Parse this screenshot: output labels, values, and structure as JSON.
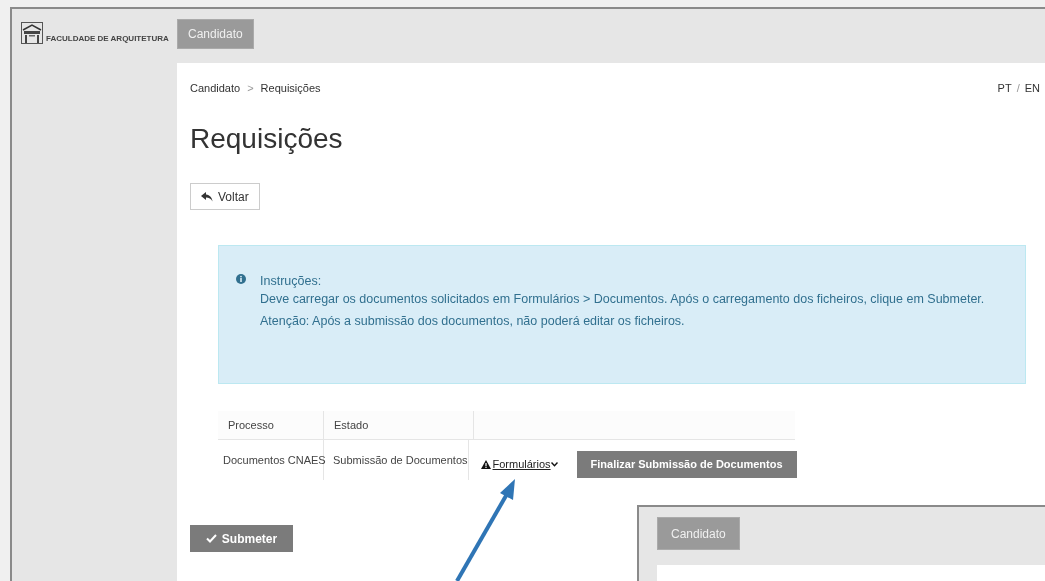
{
  "logo": {
    "title": "FACULDADE DE ARQUITETURA"
  },
  "top_tabs": [
    {
      "label": "Candidato",
      "selected": true
    }
  ],
  "breadcrumb": [
    "Candidato",
    "Requisições"
  ],
  "breadcrumb_separator": ">",
  "languages": [
    "PT",
    "EN"
  ],
  "language_separator": "/",
  "page_title": "Requisições",
  "back_button": "Voltar",
  "info": {
    "heading": "Instruções:",
    "lines": [
      "Deve carregar os documentos solicitados em Formulários > Documentos. Após o carregamento dos ficheiros, clique em Submeter.",
      "Atenção: Após a submissão dos documentos, não poderá editar os ficheiros."
    ]
  },
  "table": {
    "columns": [
      "Processo",
      "Estado"
    ],
    "rows": [
      {
        "processo": "Documentos CNAES",
        "estado": "Submissão de Documentos",
        "link": "Formulários",
        "action": "Finalizar Submissão de Documentos"
      }
    ]
  },
  "submit_button": "Submeter",
  "inset": {
    "tab": "Candidato"
  }
}
